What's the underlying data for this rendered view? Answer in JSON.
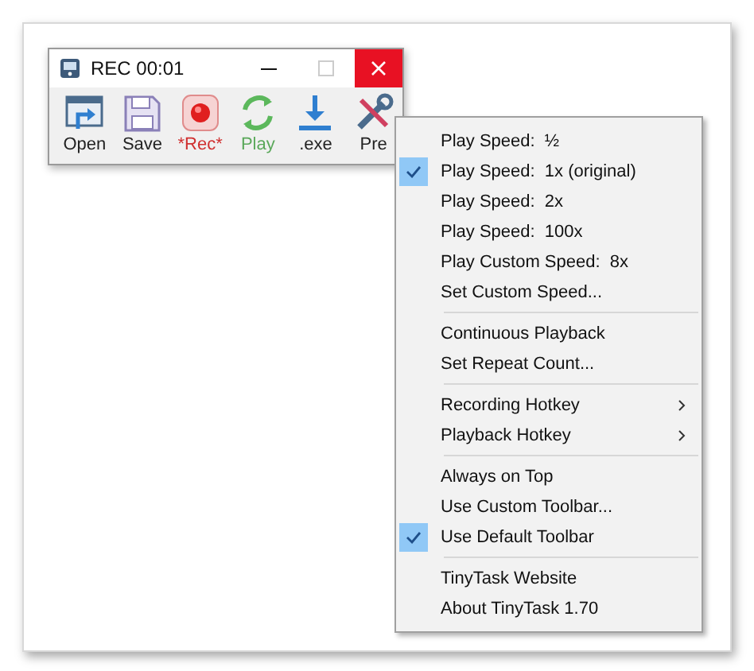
{
  "window": {
    "title": "REC 00:01"
  },
  "toolbar": [
    {
      "kind": "open",
      "label": "Open"
    },
    {
      "kind": "save",
      "label": "Save"
    },
    {
      "kind": "rec",
      "label": "*Rec*"
    },
    {
      "kind": "play",
      "label": "Play"
    },
    {
      "kind": "exe",
      "label": ".exe"
    },
    {
      "kind": "prefs",
      "label": "Pre"
    }
  ],
  "menu": [
    [
      {
        "label": "Play Speed:  ½",
        "checked": false,
        "submenu": false
      },
      {
        "label": "Play Speed:  1x (original)",
        "checked": true,
        "submenu": false
      },
      {
        "label": "Play Speed:  2x",
        "checked": false,
        "submenu": false
      },
      {
        "label": "Play Speed:  100x",
        "checked": false,
        "submenu": false
      },
      {
        "label": "Play Custom Speed:  8x",
        "checked": false,
        "submenu": false
      },
      {
        "label": "Set Custom Speed...",
        "checked": false,
        "submenu": false
      }
    ],
    [
      {
        "label": "Continuous Playback",
        "checked": false,
        "submenu": false
      },
      {
        "label": "Set Repeat Count...",
        "checked": false,
        "submenu": false
      }
    ],
    [
      {
        "label": "Recording Hotkey",
        "checked": false,
        "submenu": true
      },
      {
        "label": "Playback Hotkey",
        "checked": false,
        "submenu": true
      }
    ],
    [
      {
        "label": "Always on Top",
        "checked": false,
        "submenu": false
      },
      {
        "label": "Use Custom Toolbar...",
        "checked": false,
        "submenu": false
      },
      {
        "label": "Use Default Toolbar",
        "checked": true,
        "submenu": false
      }
    ],
    [
      {
        "label": "TinyTask Website",
        "checked": false,
        "submenu": false
      },
      {
        "label": "About TinyTask 1.70",
        "checked": false,
        "submenu": false
      }
    ]
  ]
}
